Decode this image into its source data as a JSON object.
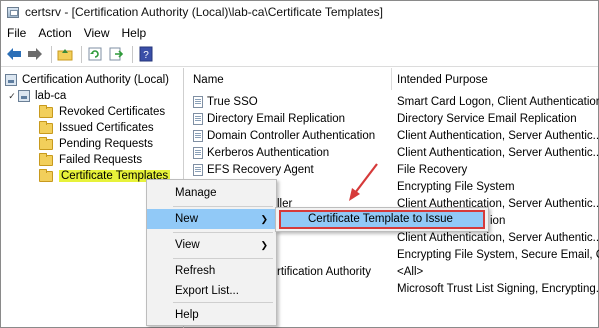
{
  "window": {
    "title": "certsrv - [Certification Authority (Local)\\lab-ca\\Certificate Templates]"
  },
  "menubar": {
    "items": [
      "File",
      "Action",
      "View",
      "Help"
    ]
  },
  "toolbar": {
    "icons": [
      "back-arrow-icon",
      "forward-arrow-icon",
      "up-folder-icon",
      "refresh-icon",
      "export-icon",
      "help-icon"
    ]
  },
  "tree": {
    "root": "Certification Authority (Local)",
    "ca": "lab-ca",
    "folders": [
      "Revoked Certificates",
      "Issued Certificates",
      "Pending Requests",
      "Failed Requests",
      "Certificate Templates"
    ]
  },
  "list": {
    "columns": {
      "name": "Name",
      "purpose": "Intended Purpose"
    },
    "rows": [
      {
        "name": "True SSO",
        "purpose": "Smart Card Logon, Client Authentication"
      },
      {
        "name": "Directory Email Replication",
        "purpose": "Directory Service Email Replication"
      },
      {
        "name": "Domain Controller Authentication",
        "purpose": "Client Authentication, Server Authentic..."
      },
      {
        "name": "Kerberos Authentication",
        "purpose": "Client Authentication, Server Authentic..."
      },
      {
        "name": "EFS Recovery Agent",
        "purpose": "File Recovery"
      },
      {
        "name": "",
        "purpose": "Encrypting File System"
      },
      {
        "name": "ller",
        "purpose": "Client Authentication, Server Authentic..."
      },
      {
        "name": "",
        "purpose": "ion"
      },
      {
        "name": "",
        "purpose": "Client Authentication, Server Authentic..."
      },
      {
        "name": "",
        "purpose": "Encrypting File System, Secure Email, Cl..."
      },
      {
        "name": "rtification Authority",
        "purpose": "<All>"
      },
      {
        "name": "",
        "purpose": "Microsoft Trust List Signing, Encrypting..."
      }
    ]
  },
  "context_menu": {
    "items": [
      "Manage",
      "New",
      "View",
      "Refresh",
      "Export List...",
      "Help"
    ],
    "submenu_item": "Certificate Template to Issue"
  },
  "colors": {
    "highlight": "#e7f23a",
    "selection": "#91c9f7",
    "annotation_red": "#d63a3a"
  }
}
